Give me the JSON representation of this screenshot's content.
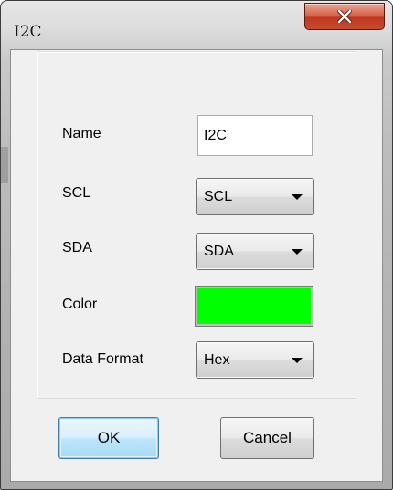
{
  "window": {
    "title": "I2C",
    "close_icon": "close-x-icon"
  },
  "form": {
    "name_label": "Name",
    "name_value": "I2C",
    "scl_label": "SCL",
    "scl_value": "SCL",
    "sda_label": "SDA",
    "sda_value": "SDA",
    "color_label": "Color",
    "color_value": "#00ff00",
    "data_format_label": "Data Format",
    "data_format_value": "Hex"
  },
  "buttons": {
    "ok_label": "OK",
    "cancel_label": "Cancel"
  },
  "icons": {
    "dropdown": "chevron-down-icon"
  },
  "colors": {
    "close_button": "#c84a2f",
    "default_button_border": "#3c7fb1"
  }
}
